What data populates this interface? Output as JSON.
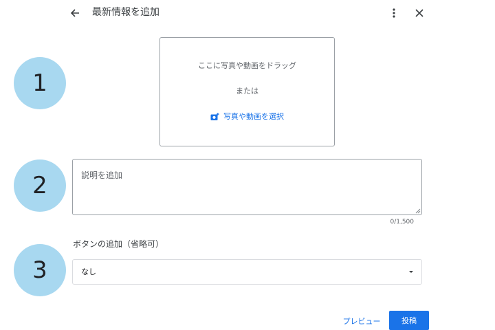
{
  "header": {
    "title": "最新情報を追加",
    "back_icon": "arrow-left-icon",
    "more_icon": "more-vert-icon",
    "close_icon": "close-icon"
  },
  "steps": [
    "1",
    "2",
    "3"
  ],
  "media": {
    "drag_text": "ここに写真や動画をドラッグ",
    "or_text": "または",
    "select_label": "写真や動画を選択",
    "select_icon": "add-photo-icon"
  },
  "description": {
    "placeholder": "説明を追加",
    "value": "",
    "counter": "0/1,500"
  },
  "button_select": {
    "label": "ボタンの追加（省略可）",
    "selected": "なし",
    "caret_icon": "caret-down-icon"
  },
  "footer": {
    "preview_label": "プレビュー",
    "post_label": "投稿"
  },
  "colors": {
    "accent": "#1a73e8",
    "step_circle": "#a8d8f0",
    "border": "#9aa0a6"
  }
}
